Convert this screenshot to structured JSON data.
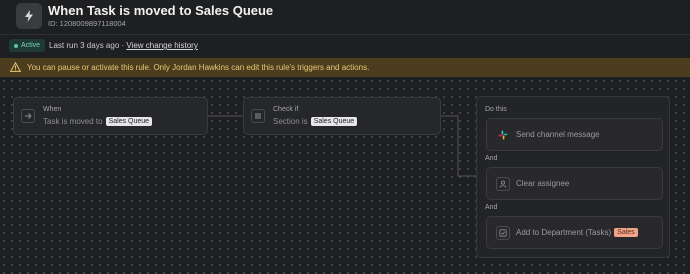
{
  "header": {
    "title": "When Task is moved to Sales Queue",
    "rule_id": "ID: 1208009897118004",
    "icon": "lightning-bolt-icon"
  },
  "status": {
    "badge": "Active",
    "last_run": "Last run 3 days ago · ",
    "history_link": "View change history"
  },
  "banner": {
    "text": "You can pause or activate this rule. Only Jordan Hawkins can edit this rule's triggers and actions.",
    "icon": "warning-icon"
  },
  "trigger": {
    "label": "When",
    "text": "Task is moved to",
    "chip": "Sales Queue",
    "icon": "arrow-right-icon"
  },
  "condition": {
    "label": "Check if",
    "text": "Section is",
    "chip": "Sales Queue",
    "icon": "list-icon"
  },
  "actions": {
    "do_this": "Do this",
    "and_1": "And",
    "and_2": "And",
    "items": [
      {
        "text": "Send channel message",
        "icon": "slack-icon"
      },
      {
        "text": "Clear assignee",
        "icon": "person-icon"
      },
      {
        "text": "Add to Department (Tasks)",
        "chip": "Sales",
        "icon": "checkbox-icon"
      }
    ]
  },
  "colors": {
    "active_badge": "#1d3b34",
    "banner_bg": "#4b3d1e",
    "banner_text": "#e8c777",
    "sales_chip": "#f0a58a"
  }
}
